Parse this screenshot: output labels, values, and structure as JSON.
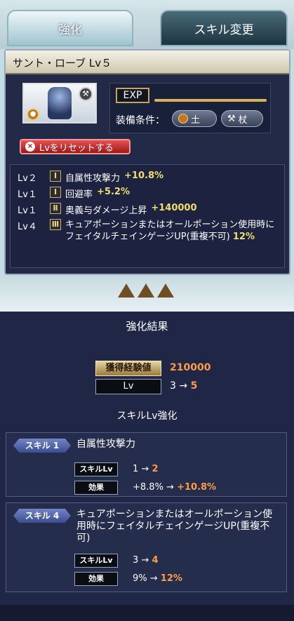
{
  "tabs": [
    "強化",
    "スキル変更"
  ],
  "item": {
    "title": "サント・ローブ Lv５",
    "exp_label": "EXP",
    "equip_label": "装備条件：",
    "element": "土",
    "weapon": "杖",
    "reset_label": "Lvをリセットする"
  },
  "skills": [
    {
      "lv": "Lv２",
      "rank": "Ⅰ",
      "name": "自属性攻撃力",
      "value": "+10.8%"
    },
    {
      "lv": "Lv１",
      "rank": "Ⅰ",
      "name": "回避率",
      "value": "+5.2%"
    },
    {
      "lv": "Lv１",
      "rank": "Ⅱ",
      "name": "奥義与ダメージ上昇",
      "value": "+140000"
    },
    {
      "lv": "Lv４",
      "rank": "Ⅲ",
      "name": "キュアポーションまたはオールポーション使用時にフェイタルチェインゲージUP(重複不可)",
      "value": "12%"
    }
  ],
  "result": {
    "title": "強化結果",
    "exp_label": "獲得経験値",
    "exp_value": "210000",
    "lv_label": "Lv",
    "lv_from": "3",
    "lv_to": "5",
    "skill_section": "スキルLv強化",
    "cards": [
      {
        "tag": "スキル 1",
        "name": "自属性攻撃力",
        "skilllv_label": "スキルLv",
        "lv_from": "1",
        "lv_to": "2",
        "effect_label": "効果",
        "eff_from": "+8.8%",
        "eff_to": "+10.8%"
      },
      {
        "tag": "スキル 4",
        "name": "キュアポーションまたはオールポーション使用時にフェイタルチェインゲージUP(重複不可)",
        "skilllv_label": "スキルLv",
        "lv_from": "3",
        "lv_to": "4",
        "effect_label": "効果",
        "eff_from": "9%",
        "eff_to": "12%"
      }
    ]
  },
  "colors": {
    "accent_yellow": "#f1de6d",
    "accent_orange": "#ff9a46",
    "panel": "#1f2646"
  },
  "icons": [
    "reset-icon",
    "earth-element-icon",
    "staff-icon",
    "triangle-icon"
  ]
}
